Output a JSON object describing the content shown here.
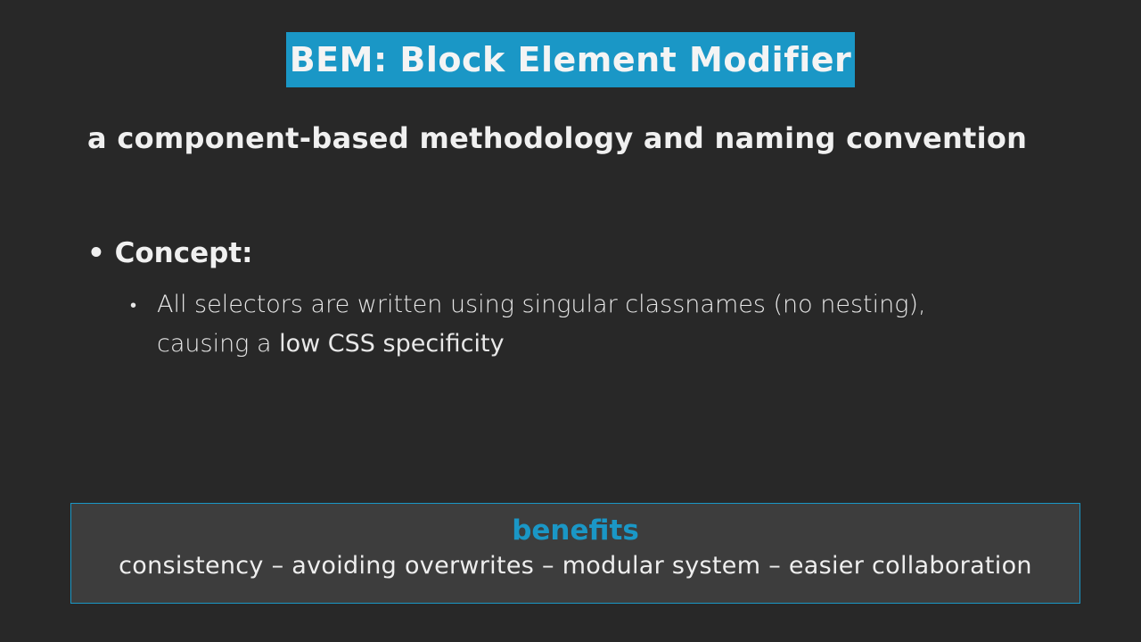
{
  "title": "BEM: Block Element Modifier",
  "subtitle": "a component-based methodology and naming convention",
  "concept": {
    "bullet": "•",
    "label": "Concept:",
    "sub_bullet": "•",
    "text_line1": "All selectors are written using singular classnames (no nesting),",
    "text_line2_prefix": "causing a ",
    "text_line2_bold": "low CSS specificity"
  },
  "benefits": {
    "heading": "benefits",
    "items": "consistency – avoiding overwrites – modular system – easier collaboration"
  },
  "colors": {
    "accent": "#1a97c6",
    "background": "#282828",
    "box": "#3d3d3d"
  }
}
